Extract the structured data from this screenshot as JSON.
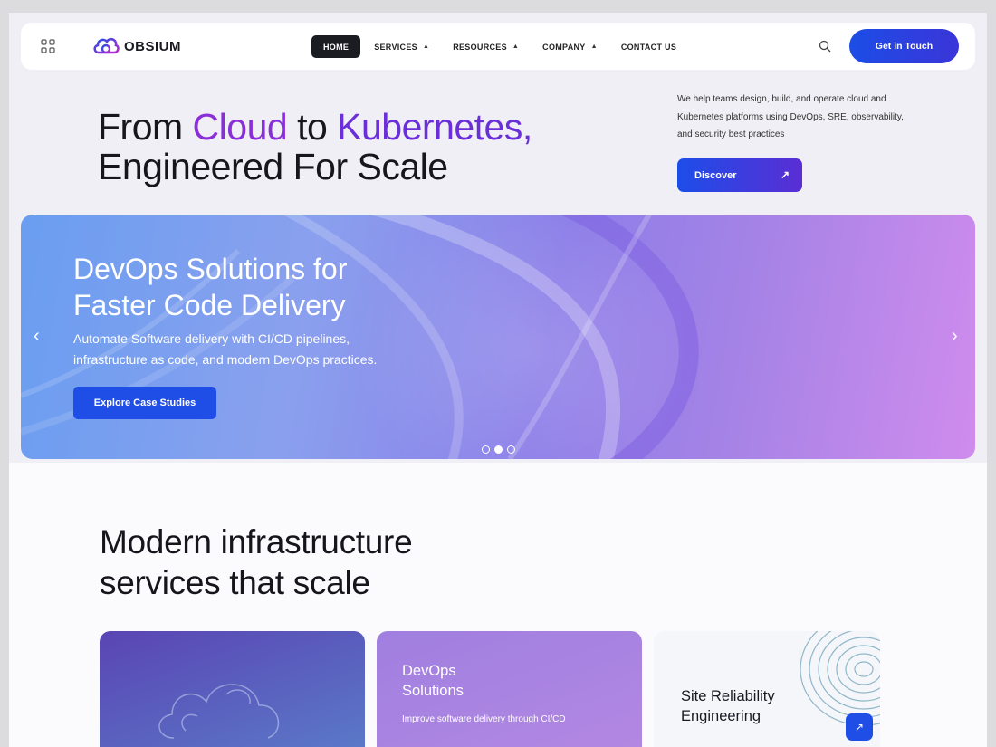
{
  "brand": {
    "name": "OBSIUM"
  },
  "nav": {
    "items": [
      {
        "label": "HOME",
        "active": true,
        "dropdown": false
      },
      {
        "label": "SERVICES",
        "active": false,
        "dropdown": true
      },
      {
        "label": "RESOURCES",
        "active": false,
        "dropdown": true
      },
      {
        "label": "COMPANY",
        "active": false,
        "dropdown": true
      },
      {
        "label": "CONTACT US",
        "active": false,
        "dropdown": false
      }
    ],
    "cta": "Get in Touch",
    "icons": {
      "menu": "grid-icon",
      "search": "search-icon"
    }
  },
  "hero": {
    "title_part1": "From ",
    "title_cloud": "Cloud",
    "title_part2": " to ",
    "title_kube": "Kubernetes,",
    "title_line2": "Engineered For Scale",
    "description": "We help teams design, build, and operate cloud and Kubernetes platforms using DevOps, SRE, observability, and security best practices",
    "button": "Discover"
  },
  "banner": {
    "title_line1": "DevOps Solutions for",
    "title_line2": "Faster Code Delivery",
    "desc_line1": "Automate Software delivery with CI/CD pipelines,",
    "desc_line2": "infrastructure as code, and modern DevOps practices.",
    "button": "Explore Case Studies",
    "slide_count": 3,
    "active_slide": 2
  },
  "services": {
    "title_line1": "Modern infrastructure",
    "title_line2": "services that scale",
    "cards": [
      {
        "title_line1": "",
        "title_line2": "",
        "desc": ""
      },
      {
        "title_line1": "DevOps",
        "title_line2": "Solutions",
        "desc": "Improve software delivery through CI/CD"
      },
      {
        "title_line1": "Site Reliability",
        "title_line2": "Engineering",
        "desc": ""
      }
    ]
  },
  "colors": {
    "accent": "#1f4ee6",
    "purple": "#8a2fd8",
    "dark": "#1b1b22"
  }
}
